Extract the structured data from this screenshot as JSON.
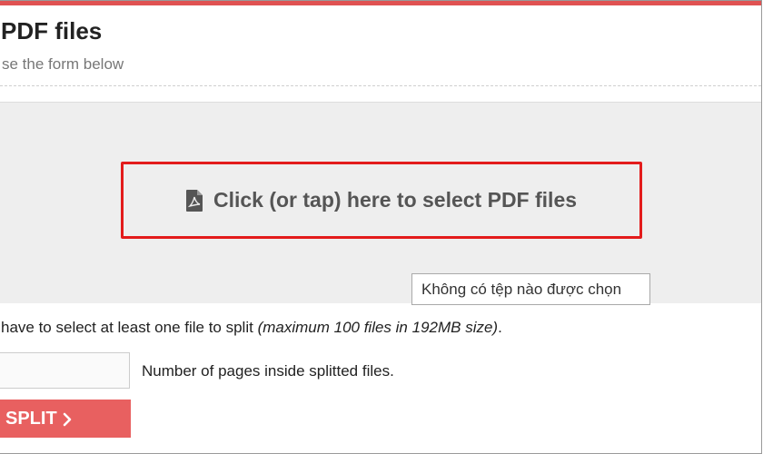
{
  "header": {
    "title": "PDF files",
    "subtitle": "se the form below"
  },
  "upload": {
    "select_label": "Click (or tap) here to select PDF files",
    "file_status": "Không có tệp nào được chọn"
  },
  "form": {
    "note_prefix": "have to select at least one file to split ",
    "note_emphasis": "(maximum 100 files in 192MB size)",
    "note_suffix": ".",
    "pages_input_value": "",
    "pages_label": "Number of pages inside splitted files.",
    "split_label": "SPLIT"
  },
  "colors": {
    "accent": "#e05252",
    "select_border": "#e31b1b",
    "split_button": "#e86060",
    "drop_area_bg": "#eeeeee"
  },
  "icons": {
    "file": "pdf-file-icon",
    "split": "chevron-right-icon"
  }
}
